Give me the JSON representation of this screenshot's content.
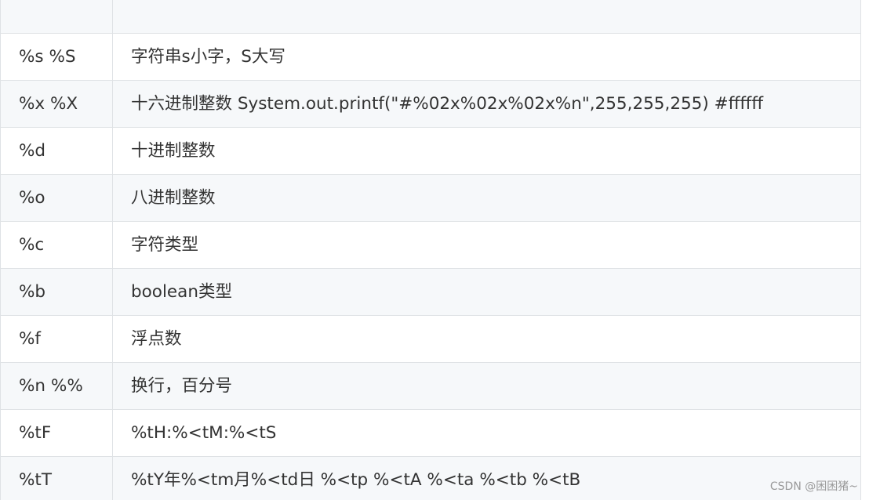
{
  "table": {
    "header": [
      "",
      ""
    ],
    "rows": [
      {
        "code": "%s %S",
        "description": "字符串s小字，S大写"
      },
      {
        "code": "%x %X",
        "description": "十六进制整数 System.out.printf(\"#%02x%02x%02x%n\",255,255,255) #ffffff"
      },
      {
        "code": "%d",
        "description": "十进制整数"
      },
      {
        "code": "%o",
        "description": "八进制整数"
      },
      {
        "code": "%c",
        "description": "字符类型"
      },
      {
        "code": "%b",
        "description": "boolean类型"
      },
      {
        "code": "%f",
        "description": "浮点数"
      },
      {
        "code": "%n %%",
        "description": "换行，百分号"
      },
      {
        "code": "%tF",
        "description": "%tH:%<tM:%<tS"
      },
      {
        "code": "%tT",
        "description": "%tY年%<tm月%<td日 %<tp %<tA %<ta %<tb %<tB"
      }
    ]
  },
  "watermark": "CSDN @困困猪~",
  "colors": {
    "stripe": "#f6f8fa",
    "border": "#dfe2e5",
    "text": "#333333",
    "watermark": "#999999"
  }
}
